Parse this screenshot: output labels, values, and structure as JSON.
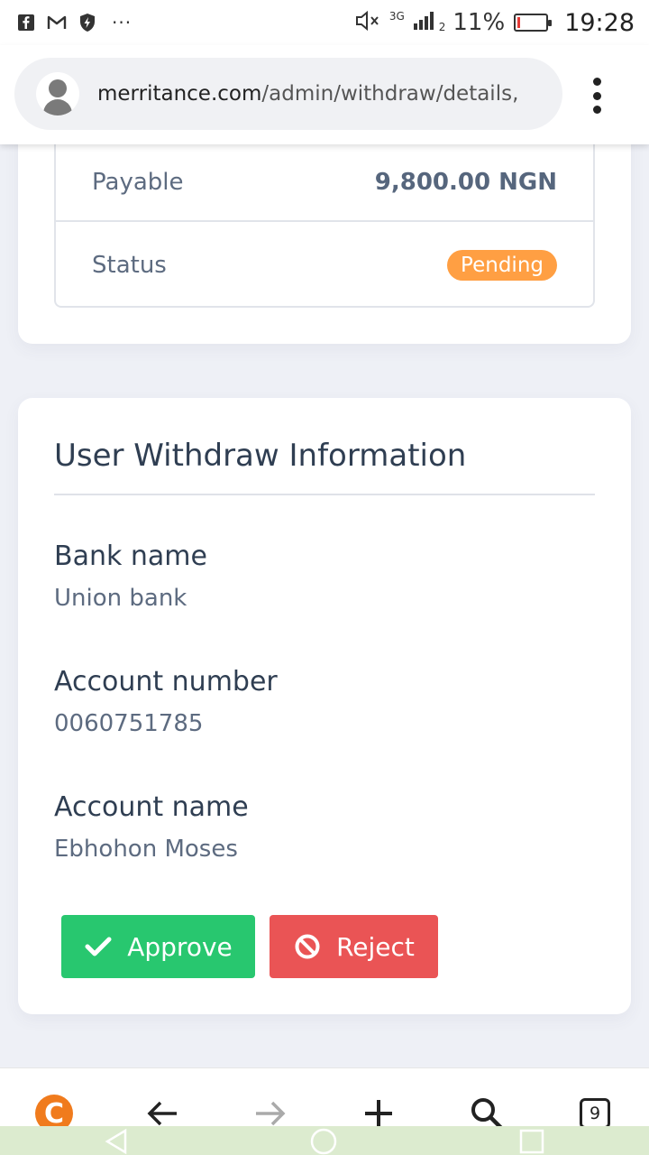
{
  "status_bar": {
    "network": "3G",
    "signal_sub": "2",
    "battery_percent": "11%",
    "time": "19:28",
    "more": "···",
    "battery_level": 0.11,
    "battery_color": "#e53935"
  },
  "browser": {
    "url_host": "merritance.com",
    "url_path": "/admin/withdraw/details,",
    "tabs_count": "9",
    "logo_letter": "C"
  },
  "summary": {
    "payable_label": "Payable",
    "payable_value": "9,800.00 NGN",
    "status_label": "Status",
    "status_value": "Pending",
    "status_color": "#ff9f43"
  },
  "info": {
    "title": "User Withdraw Information",
    "fields": [
      {
        "label": "Bank name",
        "value": "Union bank"
      },
      {
        "label": "Account number",
        "value": "0060751785"
      },
      {
        "label": "Account name",
        "value": "Ebhohon Moses"
      }
    ]
  },
  "actions": {
    "approve_label": "Approve",
    "reject_label": "Reject",
    "approve_color": "#28c76f",
    "reject_color": "#ea5455"
  },
  "icons": {
    "status_left": [
      "facebook-icon",
      "gmail-icon",
      "shield-bolt-icon"
    ],
    "status_right": [
      "mute-icon",
      "signal-icon",
      "battery-icon"
    ],
    "nav": [
      "back-arrow-icon",
      "forward-arrow-icon",
      "plus-icon",
      "search-icon",
      "tabs-icon"
    ],
    "android": [
      "back-triangle-icon",
      "home-circle-icon",
      "recents-square-icon"
    ]
  }
}
